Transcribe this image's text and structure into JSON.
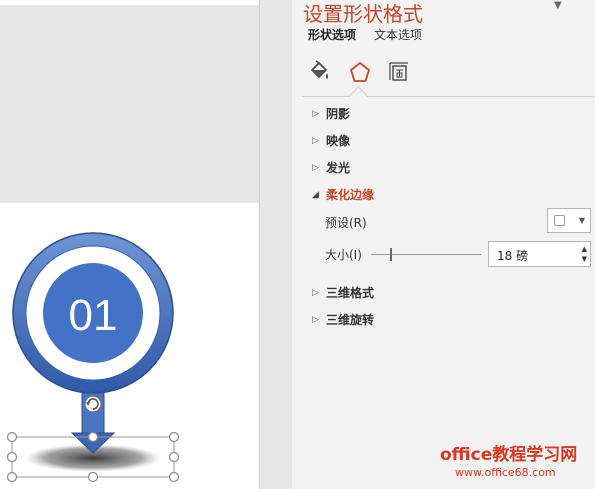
{
  "panel": {
    "title": "设置形状格式",
    "tabs": [
      {
        "label": "形状选项",
        "active": true
      },
      {
        "label": "文本选项",
        "active": false
      }
    ],
    "icon_tabs": [
      "fill-line-icon",
      "effects-pentagon-icon",
      "size-properties-icon"
    ],
    "sections": [
      {
        "label": "阴影",
        "expanded": false
      },
      {
        "label": "映像",
        "expanded": false
      },
      {
        "label": "发光",
        "expanded": false
      },
      {
        "label": "柔化边缘",
        "expanded": true
      },
      {
        "label": "三维格式",
        "expanded": false
      },
      {
        "label": "三维旋转",
        "expanded": false
      }
    ],
    "soft_edges": {
      "preset_label": "预设(R)",
      "size_label": "大小(I)",
      "size_value": "18 磅",
      "size_pt": 18
    },
    "accent_color": "#c4472b"
  },
  "slide": {
    "badge_number": "01",
    "circle_color": "#4472c4"
  },
  "watermark": {
    "title": "office教程学习网",
    "url": "www.office68.com"
  }
}
